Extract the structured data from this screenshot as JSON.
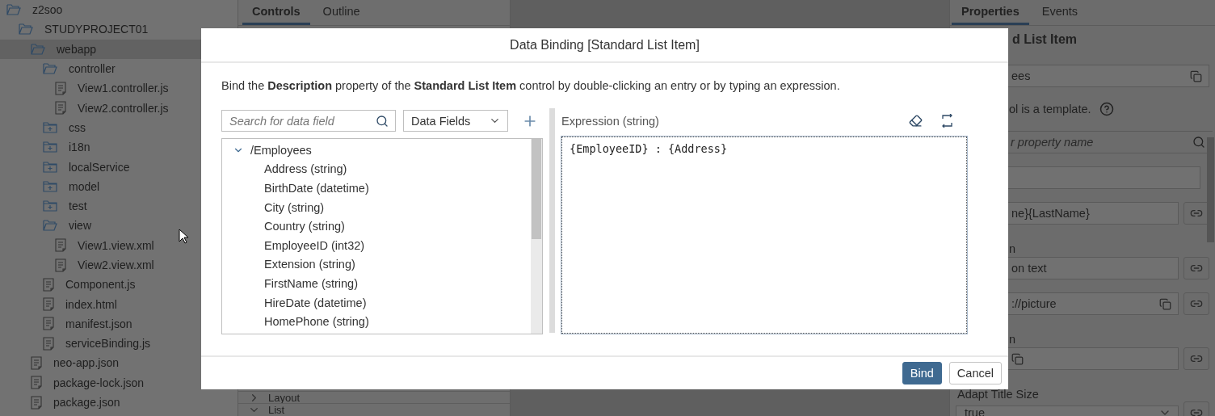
{
  "explorer": {
    "items": [
      {
        "label": "z2soo",
        "kind": "folder",
        "expanded": true,
        "selected": false,
        "children": [
          {
            "label": "STUDYPROJECT01",
            "kind": "folder",
            "expanded": true,
            "selected": false,
            "children": [
              {
                "label": "webapp",
                "kind": "folder",
                "expanded": true,
                "selected": true,
                "children": [
                  {
                    "label": "controller",
                    "kind": "folder",
                    "expanded": true,
                    "selected": false,
                    "children": [
                      {
                        "label": "View1.controller.js",
                        "kind": "file",
                        "selected": false
                      },
                      {
                        "label": "View2.controller.js",
                        "kind": "file",
                        "selected": false
                      }
                    ]
                  },
                  {
                    "label": "css",
                    "kind": "folder",
                    "expanded": false,
                    "selected": false
                  },
                  {
                    "label": "i18n",
                    "kind": "folder",
                    "expanded": false,
                    "selected": false
                  },
                  {
                    "label": "localService",
                    "kind": "folder",
                    "expanded": false,
                    "selected": false
                  },
                  {
                    "label": "model",
                    "kind": "folder",
                    "expanded": false,
                    "selected": false
                  },
                  {
                    "label": "test",
                    "kind": "folder",
                    "expanded": false,
                    "selected": false
                  },
                  {
                    "label": "view",
                    "kind": "folder",
                    "expanded": true,
                    "selected": false,
                    "children": [
                      {
                        "label": "View1.view.xml",
                        "kind": "file",
                        "selected": false
                      },
                      {
                        "label": "View2.view.xml",
                        "kind": "file",
                        "selected": false
                      }
                    ]
                  },
                  {
                    "label": "Component.js",
                    "kind": "file",
                    "selected": false
                  },
                  {
                    "label": "index.html",
                    "kind": "file",
                    "selected": false
                  },
                  {
                    "label": "manifest.json",
                    "kind": "file",
                    "selected": false
                  },
                  {
                    "label": "serviceBinding.js",
                    "kind": "file",
                    "selected": false
                  }
                ]
              },
              {
                "label": "neo-app.json",
                "kind": "file",
                "selected": false
              },
              {
                "label": "package-lock.json",
                "kind": "file",
                "selected": false
              },
              {
                "label": "package.json",
                "kind": "file",
                "selected": false
              }
            ]
          }
        ]
      }
    ]
  },
  "controls_panel": {
    "tabs": [
      {
        "label": "Controls",
        "selected": true
      },
      {
        "label": "Outline",
        "selected": false
      }
    ],
    "sections": [
      {
        "label": "Layout",
        "expanded": false
      },
      {
        "label": "List",
        "expanded": true
      }
    ]
  },
  "properties_panel": {
    "tabs": [
      {
        "label": "Properties",
        "selected": true
      },
      {
        "label": "Events",
        "selected": false
      }
    ],
    "title": "d List Item",
    "rows": [
      {
        "kind": "field",
        "value": "ees",
        "partial": true,
        "copy": true,
        "link": false
      },
      {
        "kind": "note",
        "text": "ol is a template.",
        "partial": true
      },
      {
        "kind": "search",
        "placeholder": "r property name",
        "partial": true
      },
      {
        "kind": "field",
        "partial": true,
        "copy": false,
        "link": false,
        "short": true
      },
      {
        "kind": "field",
        "value": "ne}{LastName}",
        "partial": true,
        "copy": false,
        "link": true
      },
      {
        "kind": "label",
        "text": "n",
        "partial": true
      },
      {
        "kind": "field",
        "value": "on text",
        "partial": true,
        "copy": false,
        "link": true
      },
      {
        "kind": "field",
        "value": "://picture",
        "partial": true,
        "copy": true,
        "link": true
      },
      {
        "kind": "label",
        "text": "n",
        "partial": true
      },
      {
        "kind": "field",
        "partial": true,
        "copy": true,
        "link": true
      },
      {
        "kind": "label",
        "text": "Adapt Title Size",
        "partial": false
      },
      {
        "kind": "select",
        "value": "true",
        "partial": false,
        "link": true
      }
    ]
  },
  "dialog": {
    "title": "Data Binding [Standard List Item]",
    "description": "Bind the **Description** property of the **Standard List Item** control by double-clicking an entry or by typing an expression.",
    "search": {
      "placeholder": "Search for data field"
    },
    "source": {
      "value": "Data Fields"
    },
    "fields": {
      "label": "/Employees",
      "expanded": true,
      "children": [
        {
          "label": "Address (string)"
        },
        {
          "label": "BirthDate (datetime)"
        },
        {
          "label": "City (string)"
        },
        {
          "label": "Country (string)"
        },
        {
          "label": "EmployeeID (int32)"
        },
        {
          "label": "Extension (string)"
        },
        {
          "label": "FirstName (string)"
        },
        {
          "label": "HireDate (datetime)"
        },
        {
          "label": "HomePhone (string)"
        }
      ]
    },
    "expression": {
      "label": "Expression (string)",
      "value": "{EmployeeID} : {Address}"
    },
    "buttons": [
      {
        "label": "Bind",
        "kind": "emphasized"
      },
      {
        "label": "Cancel",
        "kind": "default"
      }
    ]
  }
}
